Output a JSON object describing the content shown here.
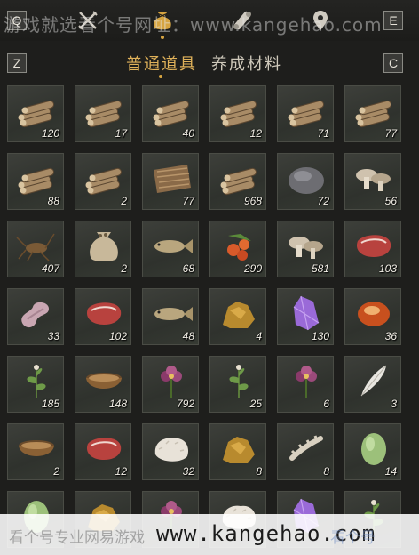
{
  "top_keys": {
    "left": "Q",
    "right": "E"
  },
  "top_icons": [
    {
      "name": "crossed-swords-icon",
      "active": false
    },
    {
      "name": "pouch-icon",
      "active": true
    },
    {
      "name": "scroll-icon",
      "active": false
    },
    {
      "name": "map-marker-icon",
      "active": false
    }
  ],
  "sub_keys": {
    "left": "Z",
    "right": "C"
  },
  "tabs": {
    "active": "普通道具",
    "inactive": "养成材料"
  },
  "watermark_top": "游戏就选看个号网址：www.kangehao.com",
  "items": [
    {
      "icon": "logs-icon",
      "count": "120"
    },
    {
      "icon": "logs-icon",
      "count": "17"
    },
    {
      "icon": "logs-icon",
      "count": "40"
    },
    {
      "icon": "logs-icon",
      "count": "12"
    },
    {
      "icon": "logs-icon",
      "count": "71"
    },
    {
      "icon": "logs-icon",
      "count": "77"
    },
    {
      "icon": "logs-icon",
      "count": "88"
    },
    {
      "icon": "logs-icon",
      "count": "2"
    },
    {
      "icon": "bark-icon",
      "count": "77"
    },
    {
      "icon": "logs-icon",
      "count": "968"
    },
    {
      "icon": "stone-icon",
      "count": "72"
    },
    {
      "icon": "mushroom-icon",
      "count": "56"
    },
    {
      "icon": "cricket-icon",
      "count": "407"
    },
    {
      "icon": "sack-icon",
      "count": "2"
    },
    {
      "icon": "fish-icon",
      "count": "68"
    },
    {
      "icon": "fruit-icon",
      "count": "290"
    },
    {
      "icon": "mushroom-icon",
      "count": "581"
    },
    {
      "icon": "meat-icon",
      "count": "103"
    },
    {
      "icon": "intestine-icon",
      "count": "33"
    },
    {
      "icon": "meat-icon",
      "count": "102"
    },
    {
      "icon": "fish-icon",
      "count": "48"
    },
    {
      "icon": "ore-icon",
      "count": "4"
    },
    {
      "icon": "crystal-icon",
      "count": "130"
    },
    {
      "icon": "gem-icon",
      "count": "36"
    },
    {
      "icon": "herb-icon",
      "count": "185"
    },
    {
      "icon": "bowl-icon",
      "count": "148"
    },
    {
      "icon": "flower-icon",
      "count": "792"
    },
    {
      "icon": "herb-icon",
      "count": "25"
    },
    {
      "icon": "flower-icon",
      "count": "6"
    },
    {
      "icon": "feather-icon",
      "count": "3"
    },
    {
      "icon": "bowl-icon",
      "count": "2"
    },
    {
      "icon": "meat-icon",
      "count": "12"
    },
    {
      "icon": "fur-icon",
      "count": "32"
    },
    {
      "icon": "ore-icon",
      "count": "8"
    },
    {
      "icon": "bone-icon",
      "count": "8"
    },
    {
      "icon": "melon-icon",
      "count": "14"
    },
    {
      "icon": "melon-icon",
      "count": ""
    },
    {
      "icon": "ore-icon",
      "count": ""
    },
    {
      "icon": "flower-icon",
      "count": ""
    },
    {
      "icon": "fur-icon",
      "count": ""
    },
    {
      "icon": "crystal-icon",
      "count": ""
    },
    {
      "icon": "herb-icon",
      "count": ""
    }
  ],
  "banner": {
    "left": "看个号专业网易游戏",
    "url": "www.kangehao.com",
    "right": "看个号"
  }
}
